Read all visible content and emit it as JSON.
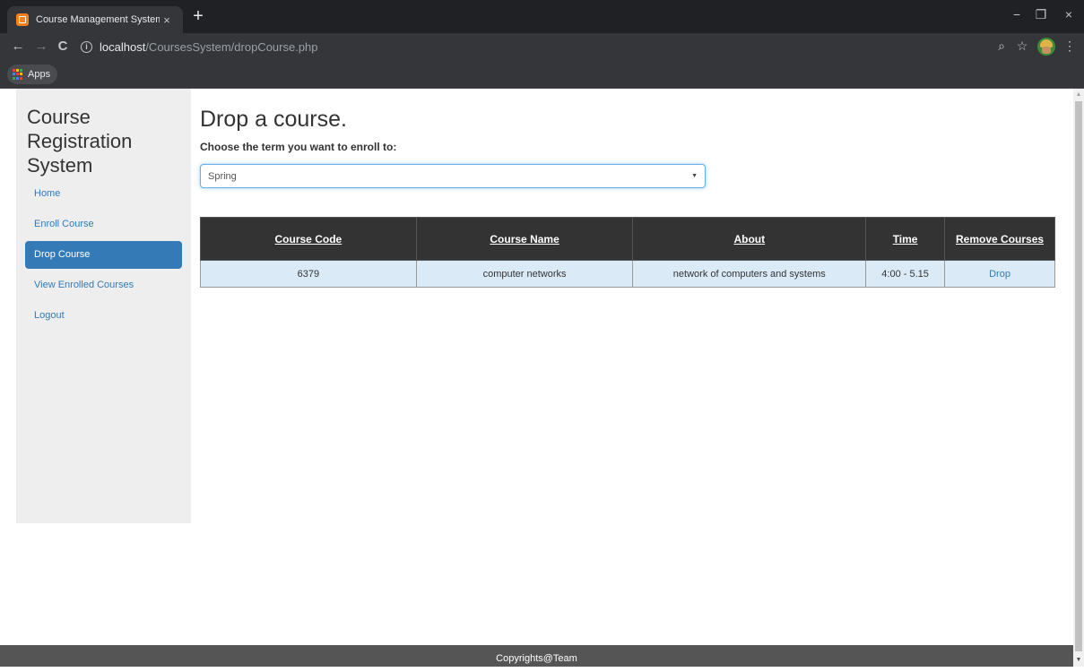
{
  "browser": {
    "tab_title": "Course Management System",
    "tab_close": "×",
    "new_tab": "+",
    "window_controls": {
      "minimize": "−",
      "maximize": "❐",
      "close": "×"
    },
    "nav": {
      "back": "←",
      "forward": "→",
      "reload": "C"
    },
    "info_icon": "i",
    "url_host": "localhost",
    "url_path": "/CoursesSystem/dropCourse.php",
    "zoom_icon": "⌕",
    "star_icon": "☆",
    "menu_icon": "⋮",
    "bookmarks": {
      "apps_label": "Apps"
    }
  },
  "sidebar": {
    "brand": "Course Registration System",
    "items": [
      {
        "label": "Home",
        "active": false
      },
      {
        "label": "Enroll Course",
        "active": false
      },
      {
        "label": "Drop Course",
        "active": true
      },
      {
        "label": "View Enrolled Courses",
        "active": false
      },
      {
        "label": "Logout",
        "active": false
      }
    ]
  },
  "main": {
    "title": "Drop a course.",
    "term_label": "Choose the term you want to enroll to:",
    "term_selected": "Spring",
    "caret": "▼",
    "table": {
      "headers": [
        "Course Code",
        "Course Name",
        "About",
        "Time",
        "Remove Courses"
      ],
      "rows": [
        [
          "6379",
          "computer networks",
          "network of computers and systems",
          "4:00 - 5.15",
          "Drop"
        ]
      ]
    }
  },
  "footer": {
    "text": "Copyrights@Team"
  },
  "colors": {
    "accent": "#337ab7",
    "table_header": "#333333",
    "row_bg": "#dbeaf7",
    "footer_bg": "#555555",
    "apps_grid": [
      "#ea4335",
      "#fbbc04",
      "#34a853",
      "#4285f4",
      "#ea4335",
      "#fbbc04",
      "#34a853",
      "#4285f4",
      "#ea4335"
    ]
  }
}
